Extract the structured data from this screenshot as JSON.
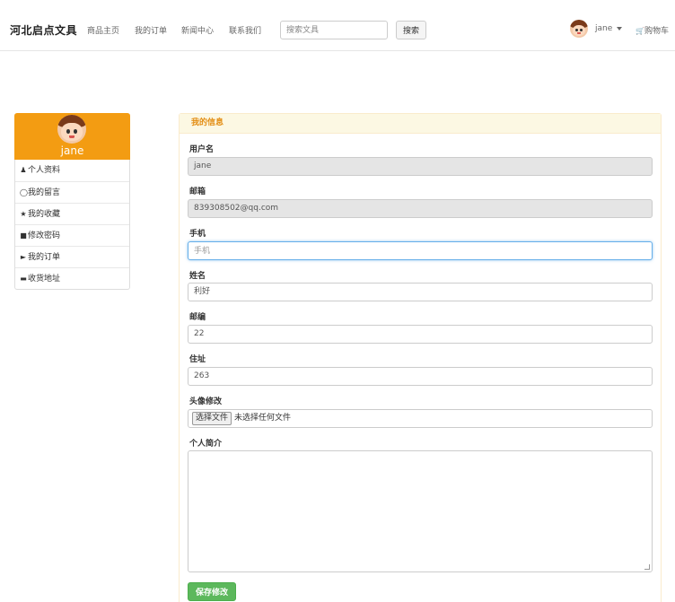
{
  "brand": "河北启点文具",
  "nav": {
    "links": [
      "商品主页",
      "我的订单",
      "新闻中心",
      "联系我们"
    ],
    "search_placeholder": "搜索文具",
    "search_button": "搜索",
    "user_name": "jane",
    "cart_label": "购物车"
  },
  "sidebar": {
    "username": "jane",
    "header_color": "#f39c12",
    "items": [
      {
        "icon": "user-icon",
        "label": "个人资料"
      },
      {
        "icon": "comment-icon",
        "label": "我的留言"
      },
      {
        "icon": "star-icon",
        "label": "我的收藏"
      },
      {
        "icon": "lock-icon",
        "label": "修改密码"
      },
      {
        "icon": "tag-icon",
        "label": "我的订单"
      },
      {
        "icon": "truck-icon",
        "label": "收货地址"
      }
    ]
  },
  "panel": {
    "title": "我的信息",
    "fields": {
      "username": {
        "label": "用户名",
        "value": "jane"
      },
      "email": {
        "label": "邮箱",
        "value": "839308502@qq.com"
      },
      "phone": {
        "label": "手机",
        "placeholder": "手机"
      },
      "realname": {
        "label": "姓名",
        "value": "利好"
      },
      "postcode": {
        "label": "邮编",
        "value": "22"
      },
      "address": {
        "label": "住址",
        "value": "263"
      },
      "avatar": {
        "label": "头像修改",
        "button": "选择文件",
        "status": "未选择任何文件"
      },
      "intro": {
        "label": "个人简介",
        "value": ""
      }
    },
    "save_button": "保存修改",
    "save_color": "#5cb85c"
  }
}
